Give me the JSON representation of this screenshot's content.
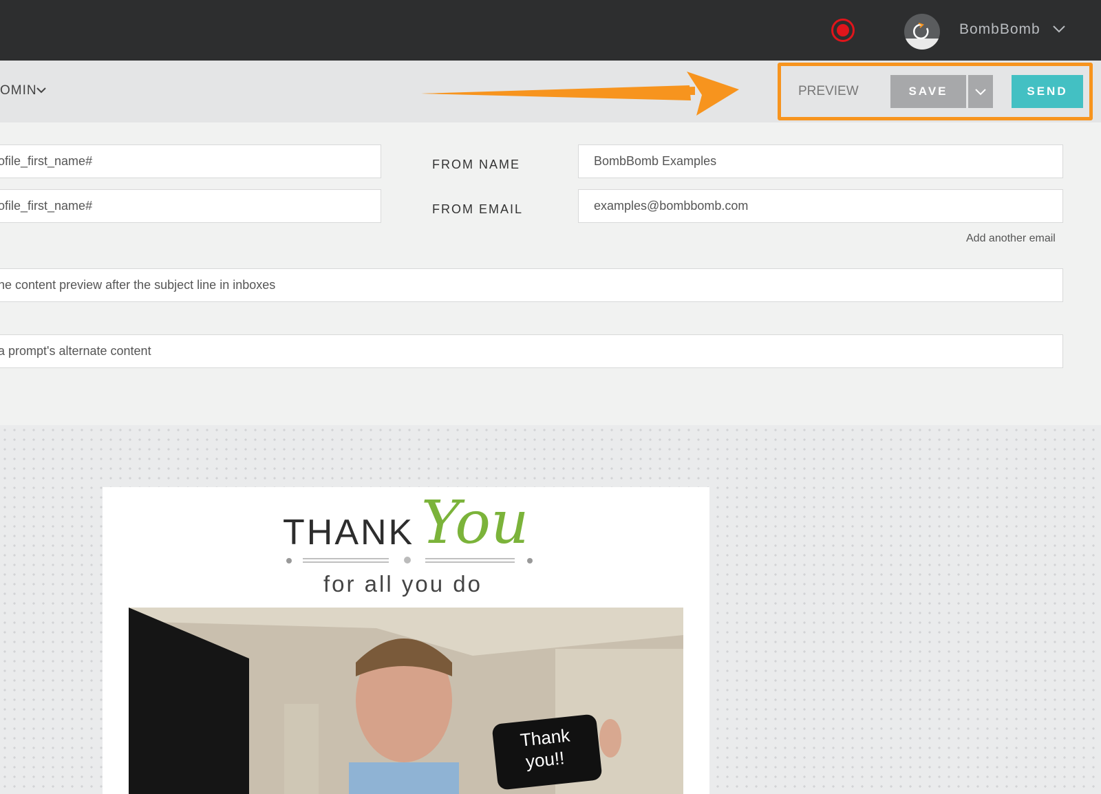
{
  "topbar": {
    "account_name": "BombBomb",
    "icons": [
      "record-icon",
      "avatar",
      "chevron-down-icon"
    ]
  },
  "toolbar": {
    "admin_label": "OMIN",
    "preview_label": "PREVIEW",
    "save_label": "SAVE",
    "send_label": "SEND"
  },
  "form": {
    "field_1": "ofile_first_name#",
    "field_2": "ofile_first_name#",
    "from_name_label": "FROM NAME",
    "from_name_value": "BombBomb Examples",
    "from_email_label": "FROM EMAIL",
    "from_email_value": "examples@bombbomb.com",
    "add_email_link": "Add another email",
    "preview_text_placeholder": "he content preview after the subject line in inboxes",
    "alt_content_placeholder": "a prompt's alternate content"
  },
  "email": {
    "thank": "THANK",
    "you": "You",
    "tagline": "for all you do",
    "video_phone_text": "Thank you!!"
  },
  "colors": {
    "topbar": "#2d2e2f",
    "send": "#43c0c3",
    "save": "#a7a8aa",
    "highlight": "#f7941e",
    "accent_green": "#7bb33a",
    "record": "#e0151b"
  }
}
